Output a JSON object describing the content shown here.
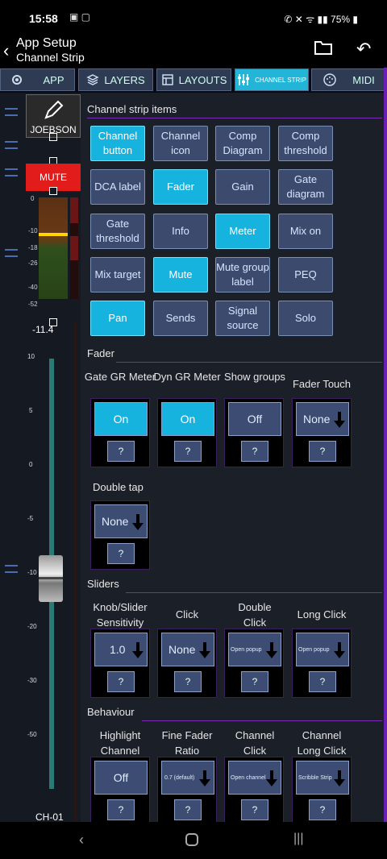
{
  "status": {
    "time": "15:58",
    "battery": "75%"
  },
  "header": {
    "title": "App Setup",
    "subtitle": "Channel Strip"
  },
  "tabs": [
    {
      "label": "APP"
    },
    {
      "label": "LAYERS"
    },
    {
      "label": "LAYOUTS"
    },
    {
      "label": "CHANNEL STRIP"
    },
    {
      "label": "MIDI"
    }
  ],
  "strip": {
    "name": "JOEBSON",
    "mute_label": "MUTE",
    "meter_scale": [
      "0",
      "-10",
      "-18",
      "-26",
      "-40",
      "-52"
    ],
    "readout": "-11.4",
    "fader_scale": [
      "10",
      "5",
      "0",
      "-5",
      "-10",
      "-20",
      "-30",
      "-50"
    ],
    "channel_label": "CH-01"
  },
  "sections": {
    "items_title": "Channel strip items",
    "fader_title": "Fader",
    "sliders_title": "Sliders",
    "behaviour_title": "Behaviour",
    "double_tap": "Double tap"
  },
  "items": [
    {
      "label": "Channel button",
      "on": true
    },
    {
      "label": "Channel icon",
      "on": false
    },
    {
      "label": "Comp Diagram",
      "on": false
    },
    {
      "label": "Comp threshold",
      "on": false
    },
    {
      "label": "DCA label",
      "on": false
    },
    {
      "label": "Fader",
      "on": true
    },
    {
      "label": "Gain",
      "on": false
    },
    {
      "label": "Gate diagram",
      "on": false
    },
    {
      "label": "Gate threshold",
      "on": false
    },
    {
      "label": "Info",
      "on": false
    },
    {
      "label": "Meter",
      "on": true
    },
    {
      "label": "Mix on",
      "on": false
    },
    {
      "label": "Mix target",
      "on": false
    },
    {
      "label": "Mute",
      "on": true
    },
    {
      "label": "Mute group label",
      "on": false
    },
    {
      "label": "PEQ",
      "on": false
    },
    {
      "label": "Pan",
      "on": true
    },
    {
      "label": "Sends",
      "on": false
    },
    {
      "label": "Signal source",
      "on": false
    },
    {
      "label": "Solo",
      "on": false
    }
  ],
  "fader_controls": [
    {
      "label": "Gate GR Meter",
      "value": "On",
      "on": true,
      "dropdown": false
    },
    {
      "label": "Dyn GR Meter",
      "value": "On",
      "on": true,
      "dropdown": false
    },
    {
      "label": "Show groups",
      "value": "Off",
      "on": false,
      "dropdown": false
    },
    {
      "label": "Fader Touch",
      "value": "None",
      "on": false,
      "dropdown": true
    }
  ],
  "double_tap": {
    "value": "None"
  },
  "slider_controls": [
    {
      "label": "Knob/Slider Sensitivity",
      "value": "1.0"
    },
    {
      "label": "Click",
      "value": "None"
    },
    {
      "label": "Double Click",
      "value": "Open popup"
    },
    {
      "label": "Long Click",
      "value": "Open popup"
    }
  ],
  "behaviour_controls": [
    {
      "label": "Highlight Channel",
      "value": "Off",
      "dropdown": false
    },
    {
      "label": "Fine Fader Ratio",
      "value": "0.7 (default)",
      "dropdown": true
    },
    {
      "label": "Channel Click",
      "value": "Open channel",
      "dropdown": true
    },
    {
      "label": "Channel Long Click",
      "value": "Scribble Strip",
      "dropdown": true
    }
  ],
  "help_label": "?",
  "colors": {
    "accent": "#17b3df",
    "mute": "#e21b1b",
    "off": "#3c4b6d"
  }
}
